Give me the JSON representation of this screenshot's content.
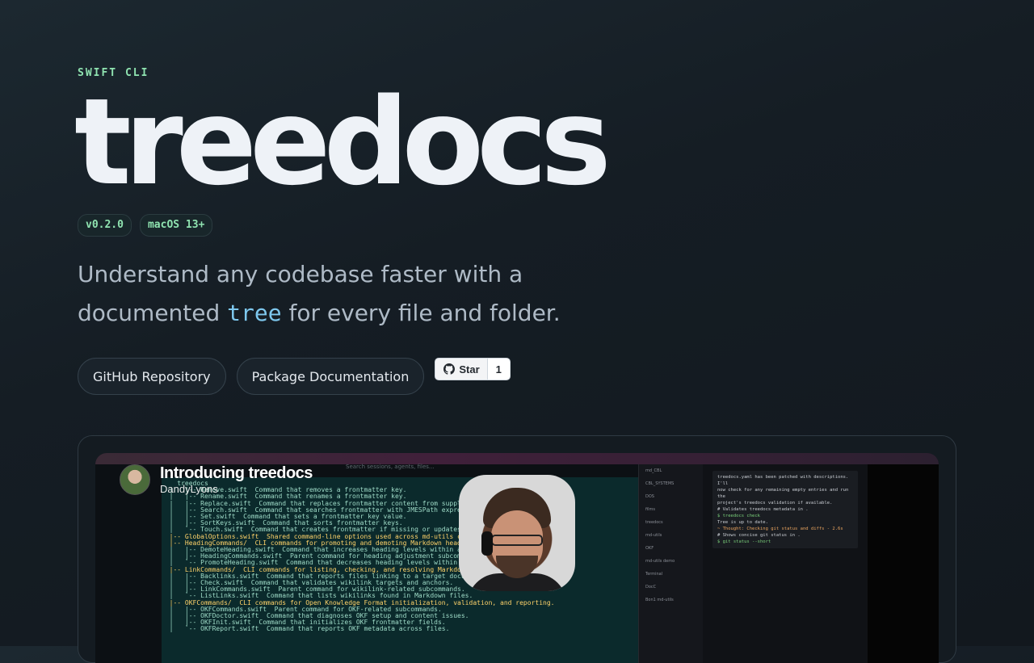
{
  "hero": {
    "eyebrow": "SWIFT CLI",
    "title": "treedocs",
    "badges": [
      "v0.2.0",
      "macOS 13+"
    ],
    "tagline_prefix": "Understand any codebase faster with a documented ",
    "tagline_code": "tree",
    "tagline_suffix": " for every file and folder."
  },
  "actions": {
    "github_label": "GitHub Repository",
    "docs_label": "Package Documentation",
    "star_label": "Star",
    "star_count": "1"
  },
  "video": {
    "title": "Introducing treedocs",
    "author": "DandyLyons",
    "search_placeholder": "Search sessions, agents, files...",
    "terminal_lines": [
      "    treedocs",
      "  |   |-- Remove.swift  Command that removes a frontmatter key.",
      "  |   |-- Rename.swift  Command that renames a frontmatter key.",
      "  |   |-- Replace.swift  Command that replaces frontmatter content from supplied",
      "  |   |-- Search.swift  Command that searches frontmatter with JMESPath expressio",
      "  |   |-- Set.swift  Command that sets a frontmatter key value.",
      "  |   |-- SortKeys.swift  Command that sorts frontmatter keys.",
      "  |   `-- Touch.swift  Command that creates frontmatter if missing or updates doc",
      "  |-- GlobalOptions.swift  Shared command-line options used across md-utils comma",
      "  |-- HeadingCommands/  CLI commands for promoting and demoting Markdown heading",
      "  |   |-- DemoteHeading.swift  Command that increases heading levels within a sel",
      "  |   |-- HeadingCommands.swift  Parent command for heading adjustment subcommands",
      "  |   `-- PromoteHeading.swift  Command that decreases heading levels within a sel",
      "  |-- LinkCommands/  CLI commands for listing, checking, and resolving Markdown wikil",
      "  |   |-- Backlinks.swift  Command that reports files linking to a target document.",
      "  |   |-- Check.swift  Command that validates wikilink targets and anchors.",
      "  |   |-- LinkCommands.swift  Parent command for wikilink-related subcommands.",
      "  |   `-- ListLinks.swift  Command that lists wikilinks found in Markdown files.",
      "  |-- OKFCommands/  CLI commands for Open Knowledge Format initialization, validation, and reporting.",
      "  |   |-- OKFCommands.swift  Parent command for OKF-related subcommands.",
      "  |   |-- OKFDoctor.swift  Command that diagnoses OKF setup and content issues.",
      "  |   |-- OKFInit.swift  Command that initializes OKF frontmatter fields.",
      "  |   `-- OKFReport.swift  Command that reports OKF metadata across files."
    ],
    "sidebar_items": [
      "md_CBL",
      "CBL_SYSTEMS",
      "DOS",
      "films",
      "treedocs",
      "md-utils",
      "OKF",
      "md-utils demo",
      "Terminal",
      "DocC",
      "Bon1 md-utils"
    ],
    "right_lines": [
      "treedocs.yaml has been patched with descriptions. I'll",
      "now check for any remaining empty entries and run the",
      "project's treedocs validation if available.",
      "# Validates treedocs metadata in .",
      "$ treedocs check",
      "Tree is up to date.",
      "~ Thought: Checking git status and diffs - 2.6s",
      "# Shows concise git status in .",
      "$ git status --short"
    ]
  },
  "colors": {
    "accent_green": "#8fe3b0",
    "code_blue": "#7ec8ee",
    "background": "#151d24"
  }
}
